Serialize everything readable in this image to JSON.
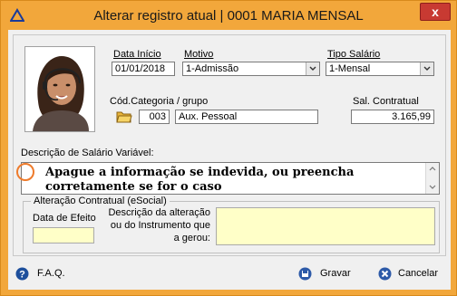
{
  "window": {
    "title": "Alterar registro atual | 0001 MARIA MENSAL",
    "close_glyph": "x",
    "accent": "#f2a73b"
  },
  "form": {
    "data_inicio": {
      "label": "Data Início",
      "value": "01/01/2018"
    },
    "motivo": {
      "label": "Motivo",
      "value": "1-Admissão"
    },
    "tipo_salario": {
      "label": "Tipo Salário",
      "value": "1-Mensal"
    },
    "categoria": {
      "label": "Cód.Categoria / grupo",
      "code": "003",
      "name": "Aux. Pessoal"
    },
    "sal_contratual": {
      "label": "Sal. Contratual",
      "value": "3.165,99"
    },
    "descricao_salario": {
      "label": "Descrição de Salário Variável:",
      "value": "Apague a informação se indevida, ou preencha corretamente se for o caso"
    },
    "alteracao": {
      "title": "Alteração Contratual (eSocial)",
      "data_efeito_label": "Data de Efeito",
      "data_efeito_value": "",
      "descricao_label_1": "Descrição da alteração",
      "descricao_label_2": "ou do Instrumento que",
      "descricao_label_3": "a gerou:",
      "descricao_value": ""
    }
  },
  "footer": {
    "faq": "F.A.Q.",
    "gravar": "Gravar",
    "cancelar": "Cancelar"
  },
  "icons": {
    "app": "delta-icon",
    "folder": "folder-icon",
    "help": "help-icon",
    "save": "save-icon",
    "cancel": "cancel-icon"
  }
}
